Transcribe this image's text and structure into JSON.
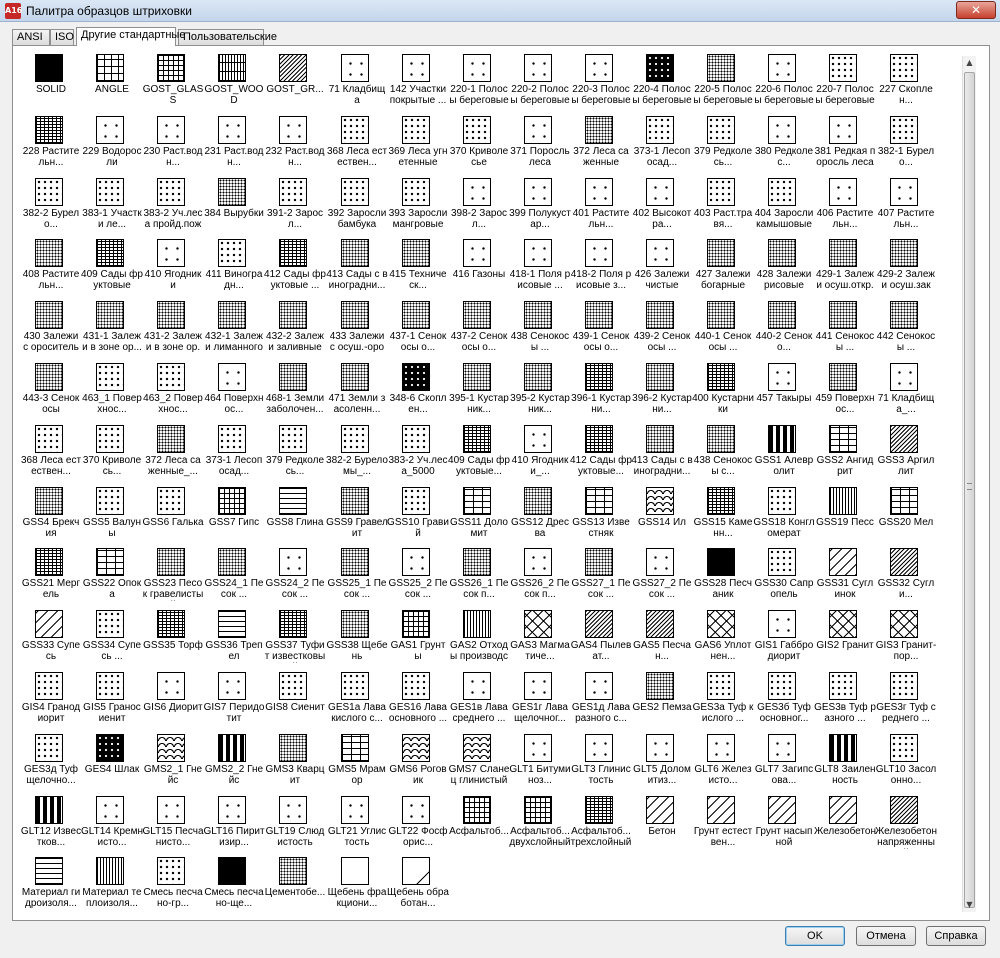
{
  "window": {
    "title": "Палитра образцов штриховки",
    "app_icon": "A16",
    "close_glyph": "✕"
  },
  "tabs": [
    {
      "label": "ANSI",
      "active": false
    },
    {
      "label": "ISO",
      "active": false
    },
    {
      "label": "Другие стандартные",
      "active": true
    },
    {
      "label": "Пользовательские",
      "active": false
    }
  ],
  "buttons": {
    "ok": "OK",
    "cancel": "Отмена",
    "help": "Справка"
  },
  "scrollbar": {
    "up_glyph": "▲",
    "down_glyph": "▼"
  },
  "patterns": [
    [
      {
        "l": "SOLID",
        "p": "solid"
      },
      {
        "l": "ANGLE",
        "p": "angle"
      },
      {
        "l": "GOST_GLASS",
        "p": "cross"
      },
      {
        "l": "GOST_WOOD",
        "p": "wood"
      },
      {
        "l": "GOST_GR...",
        "p": "diag-dense"
      },
      {
        "l": "71 Кладбища",
        "p": "sparse"
      },
      {
        "l": "142 Участки покрытые ...",
        "p": "sparse"
      },
      {
        "l": "220-1 Полосы береговые ...",
        "p": "sparse"
      },
      {
        "l": "220-2 Полосы береговые ...",
        "p": "sparse"
      },
      {
        "l": "220-3 Полосы береговые ...",
        "p": "sparse"
      },
      {
        "l": "220-4 Полосы береговые",
        "p": "dark-dots"
      },
      {
        "l": "220-5 Полосы береговые ...",
        "p": "dense-dots"
      },
      {
        "l": "220-6 Полосы береговые ...",
        "p": "sparse"
      },
      {
        "l": "220-7 Полосы береговые",
        "p": "dots"
      },
      {
        "l": "227 Скоплен...",
        "p": "dots"
      }
    ],
    [
      {
        "l": "228 Растительн...",
        "p": "brick-dense"
      },
      {
        "l": "229 Водоросли",
        "p": "sparse"
      },
      {
        "l": "230 Раст.водн...",
        "p": "sparse"
      },
      {
        "l": "231 Раст.водн...",
        "p": "sparse"
      },
      {
        "l": "232 Раст.водн...",
        "p": "sparse"
      },
      {
        "l": "368 Леса естествен...",
        "p": "dots"
      },
      {
        "l": "369 Леса угнетенные",
        "p": "dots"
      },
      {
        "l": "370 Криволесье",
        "p": "dots"
      },
      {
        "l": "371 Поросль леса",
        "p": "sparse"
      },
      {
        "l": "372 Леса саженные",
        "p": "dense-dots"
      },
      {
        "l": "373-1 Лесопосад...",
        "p": "dots"
      },
      {
        "l": "379 Редколесь...",
        "p": "dots"
      },
      {
        "l": "380 Редколес...",
        "p": "sparse"
      },
      {
        "l": "381 Редкая поросль леса",
        "p": "sparse"
      },
      {
        "l": "382-1 Бурело...",
        "p": "dots"
      }
    ],
    [
      {
        "l": "382-2 Бурело...",
        "p": "dots"
      },
      {
        "l": "383-1 Участки ле...",
        "p": "dots"
      },
      {
        "l": "383-2 Уч.леса пройд.пожа...",
        "p": "dots"
      },
      {
        "l": "384 Вырубки",
        "p": "dense-dots"
      },
      {
        "l": "391-2 Заросл...",
        "p": "dots"
      },
      {
        "l": "392 Заросли бамбука",
        "p": "dots"
      },
      {
        "l": "393 Заросли мангровые",
        "p": "dots"
      },
      {
        "l": "398-2 Заросл...",
        "p": "sparse"
      },
      {
        "l": "399 Полукустар...",
        "p": "sparse"
      },
      {
        "l": "401 Растительн...",
        "p": "sparse"
      },
      {
        "l": "402 Высокотра...",
        "p": "sparse"
      },
      {
        "l": "403 Раст.травя...",
        "p": "dots"
      },
      {
        "l": "404 Заросли камышовые",
        "p": "dots"
      },
      {
        "l": "406 Растительн...",
        "p": "sparse"
      },
      {
        "l": "407 Растительн...",
        "p": "sparse"
      }
    ],
    [
      {
        "l": "408 Растительн...",
        "p": "dense-dots"
      },
      {
        "l": "409 Сады фруктовые",
        "p": "brick-dense"
      },
      {
        "l": "410 Ягодники",
        "p": "sparse"
      },
      {
        "l": "411 Виноградн...",
        "p": "dots"
      },
      {
        "l": "412 Сады фруктовые ...",
        "p": "brick-dense"
      },
      {
        "l": "413 Сады с виноградни...",
        "p": "dense-dots"
      },
      {
        "l": "415 Техническ...",
        "p": "dense-dots"
      },
      {
        "l": "416 Газоны",
        "p": "sparse"
      },
      {
        "l": "418-1 Поля рисовые ...",
        "p": "sparse"
      },
      {
        "l": "418-2 Поля рисовые з...",
        "p": "sparse"
      },
      {
        "l": "426 Залежи чистые",
        "p": "sparse"
      },
      {
        "l": "427 Залежи богарные",
        "p": "dense-dots"
      },
      {
        "l": "428 Залежи рисовые",
        "p": "dense-dots"
      },
      {
        "l": "429-1 Залежи осуш.откр.д...",
        "p": "dense-dots"
      },
      {
        "l": "429-2 Залежи осуш.закр....",
        "p": "dense-dots"
      }
    ],
    [
      {
        "l": "430 Залежи с оросительн...",
        "p": "dense-dots"
      },
      {
        "l": "431-1 Залежи в зоне ор...",
        "p": "dense-dots"
      },
      {
        "l": "431-2 Залежи в зоне ор.н...",
        "p": "dense-dots"
      },
      {
        "l": "432-1 Залежи лиманного ...",
        "p": "dense-dots"
      },
      {
        "l": "432-2 Залежи заливные",
        "p": "dense-dots"
      },
      {
        "l": "433 Залежи с осуш.-орос....",
        "p": "dense-dots"
      },
      {
        "l": "437-1 Сенокосы о...",
        "p": "dense-dots"
      },
      {
        "l": "437-2 Сенокосы о...",
        "p": "dense-dots"
      },
      {
        "l": "438 Сенокосы ...",
        "p": "dense-dots"
      },
      {
        "l": "439-1 Сенокосы о...",
        "p": "dense-dots"
      },
      {
        "l": "439-2 Сенокосы ...",
        "p": "dense-dots"
      },
      {
        "l": "440-1 Сенокосы ...",
        "p": "dense-dots"
      },
      {
        "l": "440-2 Сеноко...",
        "p": "dense-dots"
      },
      {
        "l": "441 Сенокосы ...",
        "p": "dense-dots"
      },
      {
        "l": "442 Сенокосы ...",
        "p": "dense-dots"
      }
    ],
    [
      {
        "l": "443-3 Сенокосы",
        "p": "dense-dots"
      },
      {
        "l": "463_1 Поверхнос...",
        "p": "dots"
      },
      {
        "l": "463_2 Поверхнос...",
        "p": "dots"
      },
      {
        "l": "464 Поверхнос...",
        "p": "sparse"
      },
      {
        "l": "468-1 Земли заболочен...",
        "p": "dense-dots"
      },
      {
        "l": "471 Земли засоленн...",
        "p": "dense-dots"
      },
      {
        "l": "348-6 Скоплен...",
        "p": "dark-dots"
      },
      {
        "l": "395-1 Кустарник...",
        "p": "dense-dots"
      },
      {
        "l": "395-2 Кустарник...",
        "p": "dense-dots"
      },
      {
        "l": "396-1 Кустарни...",
        "p": "brick-dense"
      },
      {
        "l": "396-2 Кустарни...",
        "p": "dense-dots"
      },
      {
        "l": "400 Кустарники",
        "p": "brick-dense"
      },
      {
        "l": "457 Такыры",
        "p": "sparse"
      },
      {
        "l": "459 Поверхнос...",
        "p": "dense-dots"
      },
      {
        "l": "71 Кладбища_...",
        "p": "sparse"
      }
    ],
    [
      {
        "l": "368 Леса естествен...",
        "p": "dots"
      },
      {
        "l": "370 Криволесь...",
        "p": "dots"
      },
      {
        "l": "372 Леса саженные_...",
        "p": "dense-dots"
      },
      {
        "l": "373-1 Лесопосад...",
        "p": "dots"
      },
      {
        "l": "379 Редколесь...",
        "p": "dots"
      },
      {
        "l": "382-2 Буреломы_...",
        "p": "dots"
      },
      {
        "l": "383-2 Уч.леса_5000",
        "p": "dots"
      },
      {
        "l": "409 Сады фруктовые...",
        "p": "brick-dense"
      },
      {
        "l": "410 Ягодники_...",
        "p": "sparse"
      },
      {
        "l": "412 Сады фруктовые...",
        "p": "brick-dense"
      },
      {
        "l": "413 Сады с виноградни...",
        "p": "dense-dots"
      },
      {
        "l": "438 Сенокосы с...",
        "p": "dense-dots"
      },
      {
        "l": "GSS1 Алевролит",
        "p": "dash"
      },
      {
        "l": "GSS2 Ангидрит",
        "p": "brick"
      },
      {
        "l": "GSS3 Аргиллит",
        "p": "diag-dense"
      }
    ],
    [
      {
        "l": "GSS4 Брекчия",
        "p": "dense-dots"
      },
      {
        "l": "GSS5 Валуны",
        "p": "dots"
      },
      {
        "l": "GSS6 Галька",
        "p": "dots"
      },
      {
        "l": "GSS7 Гипс",
        "p": "cross"
      },
      {
        "l": "GSS8 Глина",
        "p": "hlines"
      },
      {
        "l": "GSS9 Гравелит",
        "p": "dense-dots"
      },
      {
        "l": "GSS10 Гравий",
        "p": "dots"
      },
      {
        "l": "GSS11 Доломит",
        "p": "brick"
      },
      {
        "l": "GSS12 Дресва",
        "p": "dense-dots"
      },
      {
        "l": "GSS13 Известняк",
        "p": "brick"
      },
      {
        "l": "GSS14 Ил",
        "p": "wave"
      },
      {
        "l": "GSS15 Каменн...",
        "p": "brick-dense"
      },
      {
        "l": "GSS18 Конгломерат",
        "p": "dots"
      },
      {
        "l": "GSS19 Песс",
        "p": "vlines"
      },
      {
        "l": "GSS20 Мел",
        "p": "brick"
      }
    ],
    [
      {
        "l": "GSS21 Мергель",
        "p": "brick-dense"
      },
      {
        "l": "GSS22 Опока",
        "p": "brick"
      },
      {
        "l": "GSS23 Песок гравелистый",
        "p": "dense-dots"
      },
      {
        "l": "GSS24_1 Песок ...",
        "p": "dense-dots"
      },
      {
        "l": "GSS24_2 Песок ...",
        "p": "sparse"
      },
      {
        "l": "GSS25_1 Песок ...",
        "p": "dense-dots"
      },
      {
        "l": "GSS25_2 Песок ...",
        "p": "sparse"
      },
      {
        "l": "GSS26_1 Песок п...",
        "p": "dense-dots"
      },
      {
        "l": "GSS26_2 Песок п...",
        "p": "sparse"
      },
      {
        "l": "GSS27_1 Песок ...",
        "p": "dense-dots"
      },
      {
        "l": "GSS27_2 Песок ...",
        "p": "sparse"
      },
      {
        "l": "GSS28 Песчаник",
        "p": "solid"
      },
      {
        "l": "GSS30 Сапропель",
        "p": "dots"
      },
      {
        "l": "GSS31 Суглинок",
        "p": "diag"
      },
      {
        "l": "GSS32 Сугли...",
        "p": "diag-dense"
      }
    ],
    [
      {
        "l": "GSS33 Супесь",
        "p": "diag"
      },
      {
        "l": "GSS34 Супесь ...",
        "p": "dots"
      },
      {
        "l": "GSS35 Торф",
        "p": "brick-dense"
      },
      {
        "l": "GSS36 Трепел",
        "p": "hlines"
      },
      {
        "l": "GSS37 Туфит известковый",
        "p": "brick-dense"
      },
      {
        "l": "GSS38 Щебень",
        "p": "dense-dots"
      },
      {
        "l": "GAS1 Грунты",
        "p": "cross"
      },
      {
        "l": "GAS2 Отходы производства",
        "p": "vlines"
      },
      {
        "l": "GAS3 Магматиче...",
        "p": "xcross"
      },
      {
        "l": "GAS4 Пылеват...",
        "p": "diag-dense"
      },
      {
        "l": "GAS5 Песчан...",
        "p": "diag-dense"
      },
      {
        "l": "GAS6 Уплотнен...",
        "p": "xcross"
      },
      {
        "l": "GIS1 Габбродиорит",
        "p": "sparse"
      },
      {
        "l": "GIS2 Гранит",
        "p": "xcross"
      },
      {
        "l": "GIS3 Гранит-пор...",
        "p": "xcross"
      }
    ],
    [
      {
        "l": "GIS4 Гранодиорит",
        "p": "dots"
      },
      {
        "l": "GIS5 Граносиенит",
        "p": "dots"
      },
      {
        "l": "GIS6 Диорит",
        "p": "sparse"
      },
      {
        "l": "GIS7 Перидотит",
        "p": "sparse"
      },
      {
        "l": "GIS8 Сиенит",
        "p": "dots"
      },
      {
        "l": "GES1а Лава кислого с...",
        "p": "dots"
      },
      {
        "l": "GES16 Лава основного ...",
        "p": "dots"
      },
      {
        "l": "GES1в Лава среднего ...",
        "p": "sparse"
      },
      {
        "l": "GES1г Лава щелочног...",
        "p": "sparse"
      },
      {
        "l": "GES1д Лава разного с...",
        "p": "sparse"
      },
      {
        "l": "GES2 Пемза",
        "p": "dense-dots"
      },
      {
        "l": "GES3а Туф кислого ...",
        "p": "dots"
      },
      {
        "l": "GES3б Туф основног...",
        "p": "dots"
      },
      {
        "l": "GES3в Туф разного ...",
        "p": "dots"
      },
      {
        "l": "GES3г Туф среднего ...",
        "p": "dots"
      }
    ],
    [
      {
        "l": "GES3д Туф щелочно...",
        "p": "dots"
      },
      {
        "l": "GES4 Шлак",
        "p": "dark-dots"
      },
      {
        "l": "GMS2_1 Гнейс",
        "p": "wave"
      },
      {
        "l": "GMS2_2 Гнейс",
        "p": "dash"
      },
      {
        "l": "GMS3 Кварцит",
        "p": "dense-dots"
      },
      {
        "l": "GMS5 Мрамор",
        "p": "brick"
      },
      {
        "l": "GMS6 Роговик",
        "p": "wave"
      },
      {
        "l": "GMS7 Сланец глинистый",
        "p": "wave"
      },
      {
        "l": "GLT1 Битуминоз...",
        "p": "sparse"
      },
      {
        "l": "GLT3 Глинистость",
        "p": "sparse"
      },
      {
        "l": "GLT5 Доломитиз...",
        "p": "sparse"
      },
      {
        "l": "GLT6 Железисто...",
        "p": "sparse"
      },
      {
        "l": "GLT7 Загипсова...",
        "p": "sparse"
      },
      {
        "l": "GLT8 Заиленность",
        "p": "dash"
      },
      {
        "l": "GLT10 Засолонно...",
        "p": "dots"
      }
    ],
    [
      {
        "l": "GLT12 Известков...",
        "p": "dash"
      },
      {
        "l": "GLT14 Кремнисто...",
        "p": "sparse"
      },
      {
        "l": "GLT15 Песчанисто...",
        "p": "sparse"
      },
      {
        "l": "GLT16 Пиритизир...",
        "p": "sparse"
      },
      {
        "l": "GLT19 Слюдистость",
        "p": "sparse"
      },
      {
        "l": "GLT21 Углистость",
        "p": "sparse"
      },
      {
        "l": "GLT22 Фосфорис...",
        "p": "sparse"
      },
      {
        "l": "Асфальтоб...",
        "p": "cross"
      },
      {
        "l": "Асфальтоб... двухслойный",
        "p": "cross"
      },
      {
        "l": "Асфальтоб... трехслойный",
        "p": "brick-dense"
      },
      {
        "l": "Бетон",
        "p": "diag"
      },
      {
        "l": "Грунт естествен...",
        "p": "diag"
      },
      {
        "l": "Грунт насыпной",
        "p": "diag"
      },
      {
        "l": "Железобетон",
        "p": "diag"
      },
      {
        "l": "Железобетон напряженный",
        "p": "diag-dense"
      }
    ],
    [
      {
        "l": "Материал гидроизоля...",
        "p": "hlines"
      },
      {
        "l": "Материал теплоизоля...",
        "p": "vlines"
      },
      {
        "l": "Смесь песчано-гр...",
        "p": "dots"
      },
      {
        "l": "Смесь песчано-ще...",
        "p": "solid"
      },
      {
        "l": "Цементобе...",
        "p": "dense-dots"
      },
      {
        "l": "Щебень фракциони...",
        "p": "empty"
      },
      {
        "l": "Щебень обработан...",
        "p": "corner"
      }
    ]
  ]
}
